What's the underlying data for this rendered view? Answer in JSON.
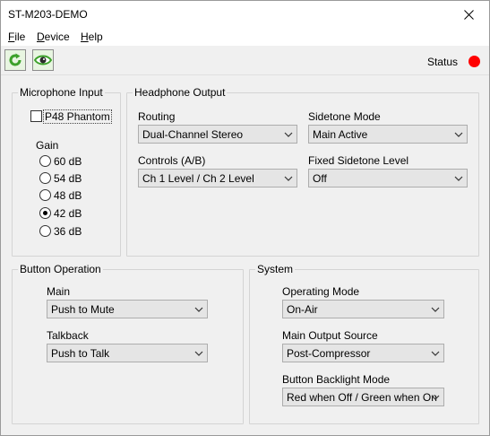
{
  "window": {
    "title": "ST-M203-DEMO"
  },
  "menu": {
    "file": "File",
    "device": "Device",
    "help": "Help"
  },
  "toolbar": {
    "status_label": "Status",
    "status_color": "#ff0000",
    "refresh_icon": "refresh-icon",
    "view_icon": "eye-icon"
  },
  "microphone": {
    "title": "Microphone Input",
    "phantom_label": "P48 Phantom",
    "phantom_checked": false,
    "gain_label": "Gain",
    "gain_options": [
      "60 dB",
      "54 dB",
      "48 dB",
      "42 dB",
      "36 dB"
    ],
    "gain_selected": "42 dB"
  },
  "headphone": {
    "title": "Headphone Output",
    "routing_label": "Routing",
    "routing_value": "Dual-Channel Stereo",
    "sidetone_mode_label": "Sidetone Mode",
    "sidetone_mode_value": "Main Active",
    "controls_label": "Controls (A/B)",
    "controls_value": "Ch 1 Level / Ch 2 Level",
    "fixed_sidetone_label": "Fixed Sidetone Level",
    "fixed_sidetone_value": "Off"
  },
  "button_operation": {
    "title": "Button Operation",
    "main_label": "Main",
    "main_value": "Push to Mute",
    "talkback_label": "Talkback",
    "talkback_value": "Push to Talk"
  },
  "system": {
    "title": "System",
    "operating_mode_label": "Operating Mode",
    "operating_mode_value": "On-Air",
    "main_output_label": "Main Output Source",
    "main_output_value": "Post-Compressor",
    "backlight_label": "Button Backlight Mode",
    "backlight_value": "Red when Off / Green when On"
  }
}
